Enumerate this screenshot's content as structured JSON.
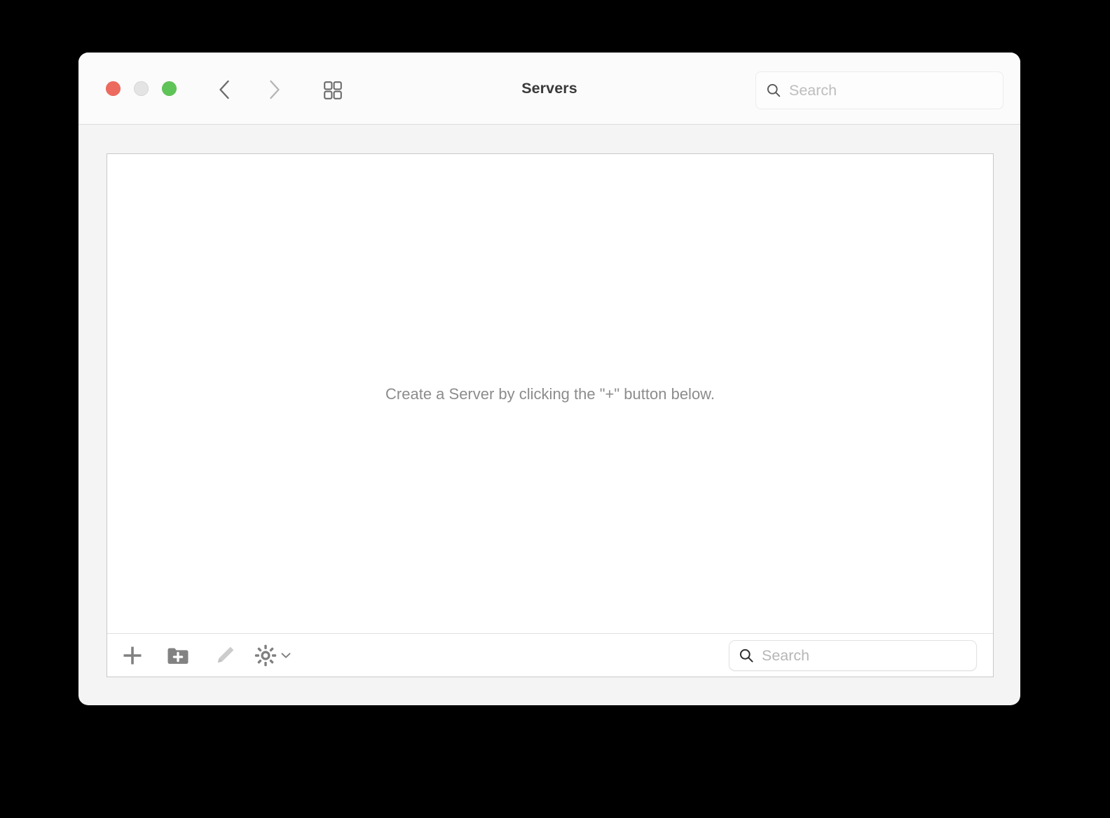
{
  "window": {
    "title": "Servers",
    "traffic_lights": [
      {
        "name": "close",
        "color": "#ed6a5e"
      },
      {
        "name": "minimize",
        "color": "#e4e4e4"
      },
      {
        "name": "zoom",
        "color": "#5fc457"
      }
    ]
  },
  "toolbar": {
    "back_icon": "chevron-left-icon",
    "forward_icon": "chevron-right-icon",
    "grid_view_icon": "grid-view-icon",
    "search": {
      "value": "",
      "placeholder": "Search",
      "icon": "search-icon"
    }
  },
  "main": {
    "empty_state_message": "Create a Server by clicking the \"+\" button below."
  },
  "bottom_toolbar": {
    "buttons": [
      {
        "name": "add-server",
        "icon": "plus-icon",
        "enabled": true
      },
      {
        "name": "add-folder",
        "icon": "folder-plus-icon",
        "enabled": true
      },
      {
        "name": "edit",
        "icon": "pencil-icon",
        "enabled": false
      },
      {
        "name": "settings",
        "icon": "gear-icon",
        "enabled": true
      }
    ],
    "settings_chevron_icon": "chevron-down-icon",
    "search": {
      "value": "",
      "placeholder": "Search",
      "icon": "search-icon"
    }
  },
  "colors": {
    "window_background": "#f4f4f4",
    "titlebar_background": "#fbfbfb",
    "panel_background": "#ffffff",
    "panel_border": "#c9c9c9",
    "empty_text": "#8c8c8c",
    "icon_default": "#808080",
    "icon_disabled": "#cccccc",
    "desktop_background": "#000000"
  }
}
